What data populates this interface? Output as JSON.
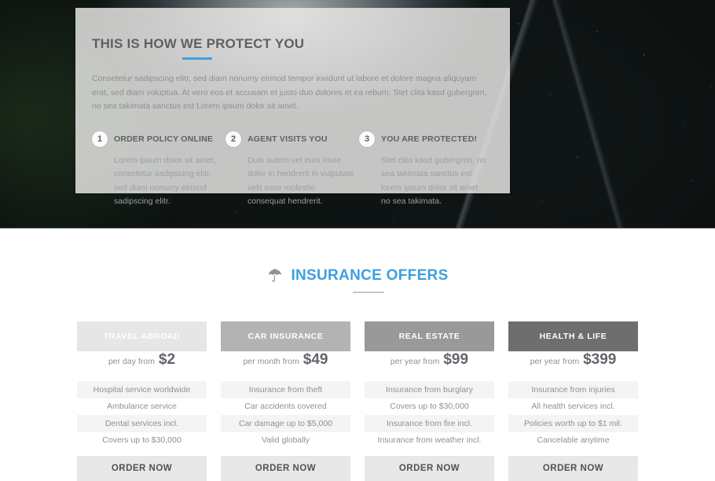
{
  "hero": {
    "panel": {
      "title": "THIS IS HOW WE PROTECT YOU",
      "accent_color": "#3f9fe0",
      "body": "Consetetur sadipscing elitr, sed diam nonumy eirmod tempor invidunt ut labore et dolore magna aliquyam erat, sed diam voluptua. At vero eos et accusam et justo duo dolores et ea rebum. Stet clita kasd gubergren, no sea takimata sanctus est Lorem ipsum dolor sit amet.",
      "steps": [
        {
          "number": "1",
          "title": "ORDER POLICY ONLINE",
          "text": "Lorem ipsum dolor sit amet, consetetur sadipscing elitr, sed diam nonumy eirmod sadipscing elitr."
        },
        {
          "number": "2",
          "title": "AGENT VISITS YOU",
          "text": "Duis autem vel eum iriure dolor in hendrerit in vulputate velit esse molestie consequat hendrerit."
        },
        {
          "number": "3",
          "title": "YOU ARE PROTECTED!",
          "text": "Stet clita kasd gubergren, no sea takimata sanctus est lorem ipsum dolor sit amet no sea takimata."
        }
      ]
    }
  },
  "offers": {
    "icon": "umbrella-icon",
    "title": "INSURANCE OFFERS",
    "title_color": "#3d9fe0",
    "cards": [
      {
        "name": "TRAVEL ABROAD",
        "header_color": "#e6e6e6",
        "price_label": "per day from",
        "price_value": "$2",
        "features": [
          "Hospital service worldwide",
          "Ambulance service",
          "Dental services incl.",
          "Covers up to $30,000"
        ],
        "cta": "ORDER NOW"
      },
      {
        "name": "CAR INSURANCE",
        "header_color": "#b3b3b3",
        "price_label": "per month from",
        "price_value": "$49",
        "features": [
          "Insurance from theft",
          "Car accidents covered",
          "Car damage up to $5,000",
          "Valid globally"
        ],
        "cta": "ORDER NOW"
      },
      {
        "name": "REAL ESTATE",
        "header_color": "#999999",
        "price_label": "per year from",
        "price_value": "$99",
        "features": [
          "Insurance from burglary",
          "Covers up to $30,000",
          "Insurance from fire incl.",
          "Insurance from weather incl."
        ],
        "cta": "ORDER NOW"
      },
      {
        "name": "HEALTH & LIFE",
        "header_color": "#6e6e6e",
        "price_label": "per year from",
        "price_value": "$399",
        "features": [
          "Insurance from injuries",
          "All health services incl.",
          "Policies worth up to $1 mil.",
          "Cancelable anytime"
        ],
        "cta": "ORDER NOW"
      }
    ]
  }
}
